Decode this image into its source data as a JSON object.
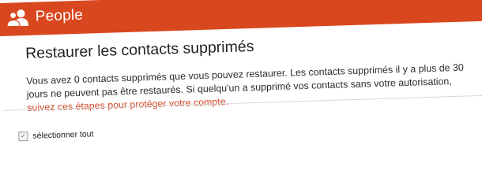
{
  "header": {
    "app_icon": "people-icon",
    "app_name": "People",
    "accent_color": "#d9471f"
  },
  "main": {
    "title": "Restaurer les contacts supprimés",
    "line1": "Vous avez 0 contacts supprimés que vous pouvez restaurer. Les contacts supprimés il y a plus de 30",
    "line2": "jours ne peuvent pas être restaurés. Si quelqu'un a supprimé vos contacts sans votre autorisation,",
    "link_text": "suivez ces étapes pour protéger votre compte.",
    "link_color": "#d24726"
  },
  "selection": {
    "select_all_label": "sélectionner tout",
    "checkbox_icon": "check-icon"
  }
}
